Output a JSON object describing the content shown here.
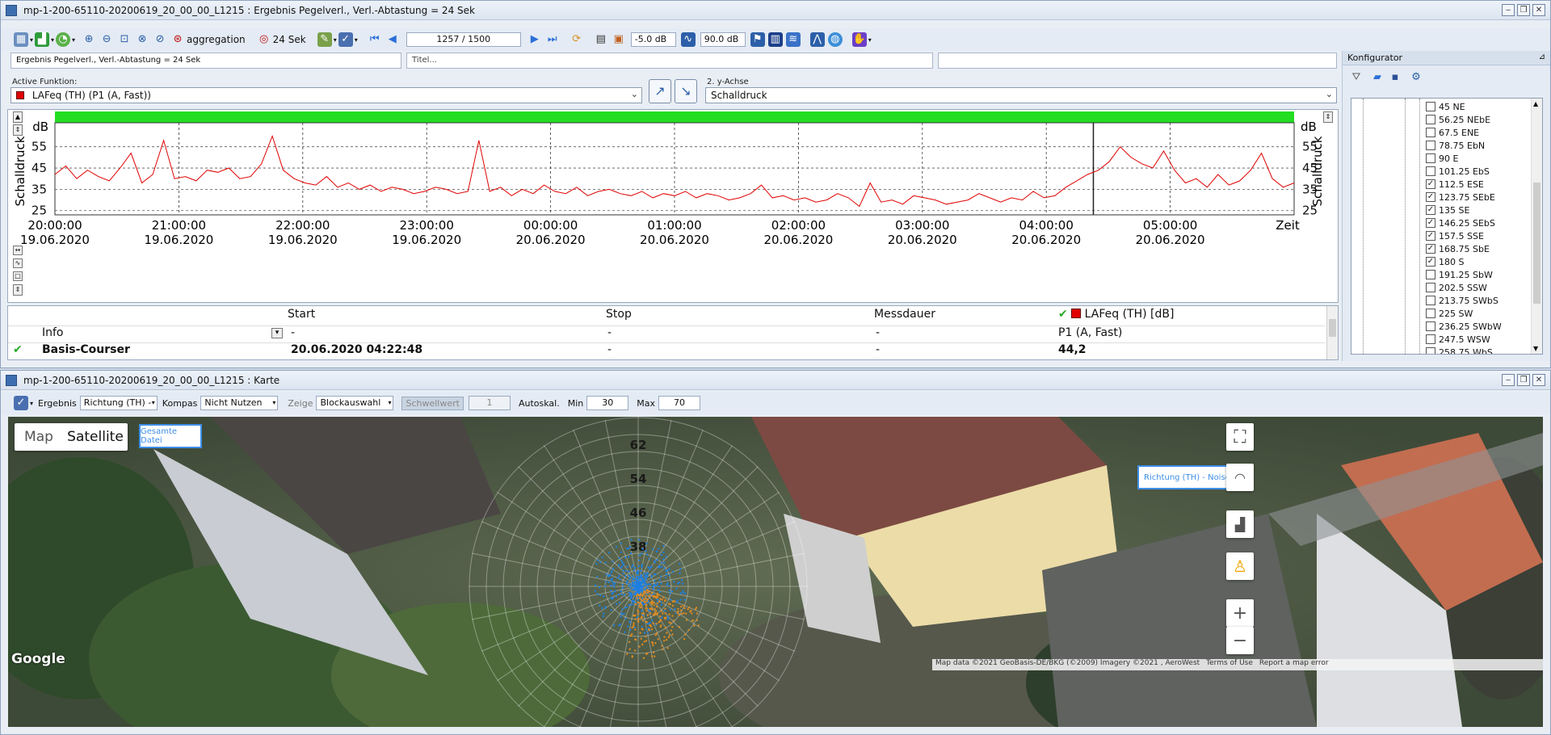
{
  "top_window": {
    "title": "mp-1-200-65110-20200619_20_00_00_L1215 : Ergebnis Pegelverl., Verl.-Abtastung = 24 Sek",
    "toolbar": {
      "aggregation_label": "aggregation",
      "interval_label": "24 Sek",
      "position_value": "1257 / 1500",
      "db_min": "-5.0 dB",
      "db_max": "90.0 dB"
    },
    "fields": {
      "result_name": "Ergebnis Pegelverl., Verl.-Abtastung = 24 Sek",
      "title_placeholder": "Titel..."
    },
    "active_function": {
      "label": "Active Funktion:",
      "value": "LAFeq (TH) (P1 (A, Fast))"
    },
    "second_axis": {
      "label": "2. y-Achse",
      "value": "Schalldruck"
    }
  },
  "chart_data": {
    "type": "line",
    "ylabel": "Schalldruck",
    "unit_label": "dB",
    "xlabel_right": "Zeit",
    "yticks": [
      25,
      35,
      45,
      55
    ],
    "ylim": [
      23,
      64
    ],
    "xticks": [
      {
        "time": "20:00:00",
        "date": "19.06.2020"
      },
      {
        "time": "21:00:00",
        "date": "19.06.2020"
      },
      {
        "time": "22:00:00",
        "date": "19.06.2020"
      },
      {
        "time": "23:00:00",
        "date": "19.06.2020"
      },
      {
        "time": "00:00:00",
        "date": "20.06.2020"
      },
      {
        "time": "01:00:00",
        "date": "20.06.2020"
      },
      {
        "time": "02:00:00",
        "date": "20.06.2020"
      },
      {
        "time": "03:00:00",
        "date": "20.06.2020"
      },
      {
        "time": "04:00:00",
        "date": "20.06.2020"
      },
      {
        "time": "05:00:00",
        "date": "20.06.2020"
      }
    ],
    "xlim_hours": [
      0,
      10
    ],
    "cursor_hour": 8.38,
    "series": [
      {
        "color": "#e00000",
        "x_hours": [
          0,
          0.1,
          0.2,
          0.3,
          0.4,
          0.5,
          0.6,
          0.7,
          0.8,
          0.9,
          1.0,
          1.1,
          1.2,
          1.3,
          1.4,
          1.5,
          1.6,
          1.7,
          1.8,
          1.9,
          2.0,
          2.1,
          2.2,
          2.3,
          2.4,
          2.5,
          2.6,
          2.7,
          2.8,
          2.9,
          3.0,
          3.1,
          3.2,
          3.3,
          3.4,
          3.5,
          3.6,
          3.7,
          3.8,
          3.9,
          4.0,
          4.1,
          4.2,
          4.3,
          4.4,
          4.5,
          4.6,
          4.7,
          4.8,
          4.9,
          5.0,
          5.1,
          5.2,
          5.3,
          5.4,
          5.5,
          5.6,
          5.7,
          5.8,
          5.9,
          6.0,
          6.1,
          6.2,
          6.3,
          6.4,
          6.5,
          6.6,
          6.7,
          6.8,
          6.9,
          7.0,
          7.1,
          7.2,
          7.3,
          7.4,
          7.5,
          7.6,
          7.7,
          7.8,
          7.9,
          8.0,
          8.1,
          8.2,
          8.3,
          8.4,
          8.5,
          8.6,
          8.7,
          8.8,
          8.9,
          9.0,
          9.1,
          9.2,
          9.3,
          9.4,
          9.5,
          9.6,
          9.7,
          9.8,
          9.9,
          10.0
        ],
        "values": [
          42,
          46,
          40,
          44,
          41,
          39,
          45,
          52,
          38,
          42,
          58,
          40,
          41,
          39,
          44,
          43,
          45,
          40,
          41,
          47,
          60,
          44,
          40,
          38,
          37,
          41,
          36,
          38,
          35,
          37,
          34,
          36,
          35,
          33,
          34,
          36,
          35,
          33,
          34,
          58,
          34,
          36,
          32,
          35,
          33,
          37,
          34,
          33,
          36,
          32,
          34,
          35,
          33,
          32,
          34,
          31,
          33,
          32,
          34,
          31,
          33,
          32,
          30,
          31,
          33,
          37,
          31,
          32,
          30,
          31,
          29,
          30,
          33,
          31,
          27,
          38,
          29,
          30,
          28,
          32,
          31,
          30,
          28,
          29,
          30,
          33,
          31,
          29,
          31,
          30,
          34,
          31,
          32,
          36,
          39,
          42,
          44,
          48,
          55,
          50,
          47,
          45,
          53,
          44,
          38,
          40,
          36,
          42,
          37,
          39,
          44,
          52,
          40,
          36,
          38
        ]
      }
    ]
  },
  "info_table": {
    "headers": {
      "start": "Start",
      "stop": "Stop",
      "duration": "Messdauer",
      "series": "LAFeq (TH) [dB]"
    },
    "row1": {
      "label": "Info",
      "start": "-",
      "stop": "-",
      "duration": "-",
      "series": "P1 (A, Fast)"
    },
    "row2": {
      "label": "Basis-Courser",
      "start": "20.06.2020 04:22:48",
      "stop": "-",
      "duration": "-",
      "series": "44,2"
    }
  },
  "konfigurator": {
    "title": "Konfigurator",
    "items": [
      {
        "label": "45 NE",
        "checked": false
      },
      {
        "label": "56.25 NEbE",
        "checked": false
      },
      {
        "label": "67.5 ENE",
        "checked": false
      },
      {
        "label": "78.75 EbN",
        "checked": false
      },
      {
        "label": "90 E",
        "checked": false
      },
      {
        "label": "101.25 EbS",
        "checked": false
      },
      {
        "label": "112.5 ESE",
        "checked": true
      },
      {
        "label": "123.75 SEbE",
        "checked": true
      },
      {
        "label": "135 SE",
        "checked": true
      },
      {
        "label": "146.25 SEbS",
        "checked": true
      },
      {
        "label": "157.5 SSE",
        "checked": true
      },
      {
        "label": "168.75 SbE",
        "checked": true
      },
      {
        "label": "180 S",
        "checked": true
      },
      {
        "label": "191.25 SbW",
        "checked": false
      },
      {
        "label": "202.5 SSW",
        "checked": false
      },
      {
        "label": "213.75 SWbS",
        "checked": false
      },
      {
        "label": "225 SW",
        "checked": false
      },
      {
        "label": "236.25 SWbW",
        "checked": false
      },
      {
        "label": "247.5 WSW",
        "checked": false
      },
      {
        "label": "258.75 WbS",
        "checked": false
      }
    ]
  },
  "map_window": {
    "title": "mp-1-200-65110-20200619_20_00_00_L1215 : Karte",
    "toolbar": {
      "ergebnis_label": "Ergebnis",
      "ergebnis_value": "Richtung (TH) -",
      "kompas_label": "Kompas",
      "kompas_value": "Nicht Nutzen",
      "zeige_label": "Zeige",
      "zeige_value": "Blockauswahl",
      "schwellwert_label": "Schwellwert",
      "schwellwert_value": "1",
      "autoskal_label": "Autoskal.",
      "min_label": "Min",
      "min_value": "30",
      "max_label": "Max",
      "max_value": "70"
    },
    "map_type_map": "Map",
    "map_type_satellite": "Satellite",
    "gesamte_datei": "Gesamte Datei",
    "legend_label": "Richtung (TH) - Noise so",
    "polar_labels": [
      "62",
      "54",
      "46",
      "38"
    ],
    "google_logo": "Google",
    "attribution": "Map data ©2021 GeoBasis-DE/BKG (©2009) Imagery ©2021 , AeroWest",
    "terms": "Terms of Use",
    "report": "Report a map error"
  },
  "colors": {
    "accent": "#3d8ee8",
    "green_bar": "#22dd22",
    "series_red": "#e00000"
  }
}
